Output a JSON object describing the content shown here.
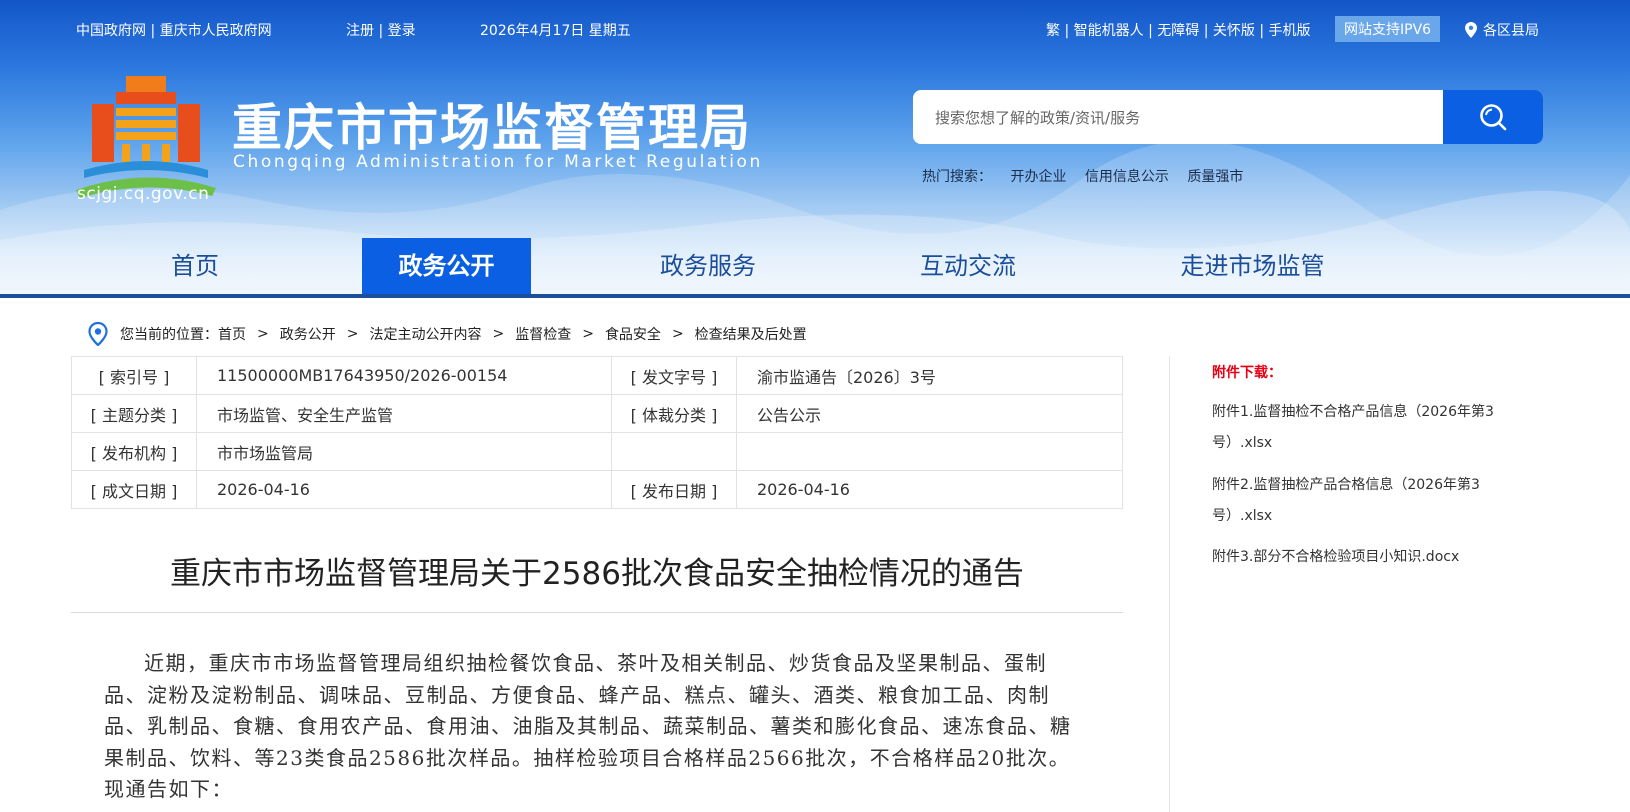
{
  "topbar": {
    "gov_link": "中国政府网",
    "city_link": "重庆市人民政府网",
    "register": "注册",
    "login": "登录",
    "date": "2026年4月17日 星期五",
    "traditional": "繁",
    "robot": "智能机器人",
    "accessibility": "无障碍",
    "care": "关怀版",
    "mobile": "手机版",
    "ipv6": "网站支持IPV6",
    "districts": "各区县局"
  },
  "site": {
    "title": "重庆市市场监督管理局",
    "subtitle": "Chongqing  Administration for Market Regulation",
    "domain": "scjgj.cq.gov.cn"
  },
  "search": {
    "placeholder": "搜索您想了解的政策/资讯/服务",
    "hot_label": "热门搜索：",
    "hot": [
      "开办企业",
      "信用信息公示",
      "质量强市"
    ]
  },
  "nav": [
    "首页",
    "政务公开",
    "政务服务",
    "互动交流",
    "走进市场监管"
  ],
  "breadcrumb": {
    "label": "您当前的位置：",
    "items": [
      "首页",
      "政务公开",
      "法定主动公开内容",
      "监督检查",
      "食品安全",
      "检查结果及后处置"
    ]
  },
  "meta": {
    "index_label": "[ 索引号 ]",
    "index_value": "11500000MB17643950/2026-00154",
    "docno_label": "[ 发文字号 ]",
    "docno_value": "渝市监通告〔2026〕3号",
    "topic_label": "[ 主题分类 ]",
    "topic_value": "市场监管、安全生产监管",
    "genre_label": "[ 体裁分类 ]",
    "genre_value": "公告公示",
    "org_label": "[ 发布机构 ]",
    "org_value": "市市场监管局",
    "doc_date_label": "[ 成文日期 ]",
    "doc_date_value": "2026-04-16",
    "pub_date_label": "[ 发布日期 ]",
    "pub_date_value": "2026-04-16"
  },
  "article": {
    "title": "重庆市市场监督管理局关于2586批次食品安全抽检情况的通告",
    "body": "近期，重庆市市场监督管理局组织抽检餐饮食品、茶叶及相关制品、炒货食品及坚果制品、蛋制品、淀粉及淀粉制品、调味品、豆制品、方便食品、蜂产品、糕点、罐头、酒类、粮食加工品、肉制品、乳制品、食糖、食用农产品、食用油、油脂及其制品、蔬菜制品、薯类和膨化食品、速冻食品、糖果制品、饮料、等23类食品2586批次样品。抽样检验项目合格样品2566批次，不合格样品20批次。现通告如下："
  },
  "attachments": {
    "heading": "附件下载：",
    "items": [
      "附件1.监督抽检不合格产品信息（2026年第3号）.xlsx",
      "附件2.监督抽检产品合格信息（2026年第3号）.xlsx",
      "附件3.部分不合格检验项目小知识.docx"
    ]
  },
  "colors": {
    "nav_active": "#0a5fe2",
    "nav_active_underline": "#e60012",
    "attachment_heading": "#e60012",
    "nav_text": "#1b4e9a"
  }
}
